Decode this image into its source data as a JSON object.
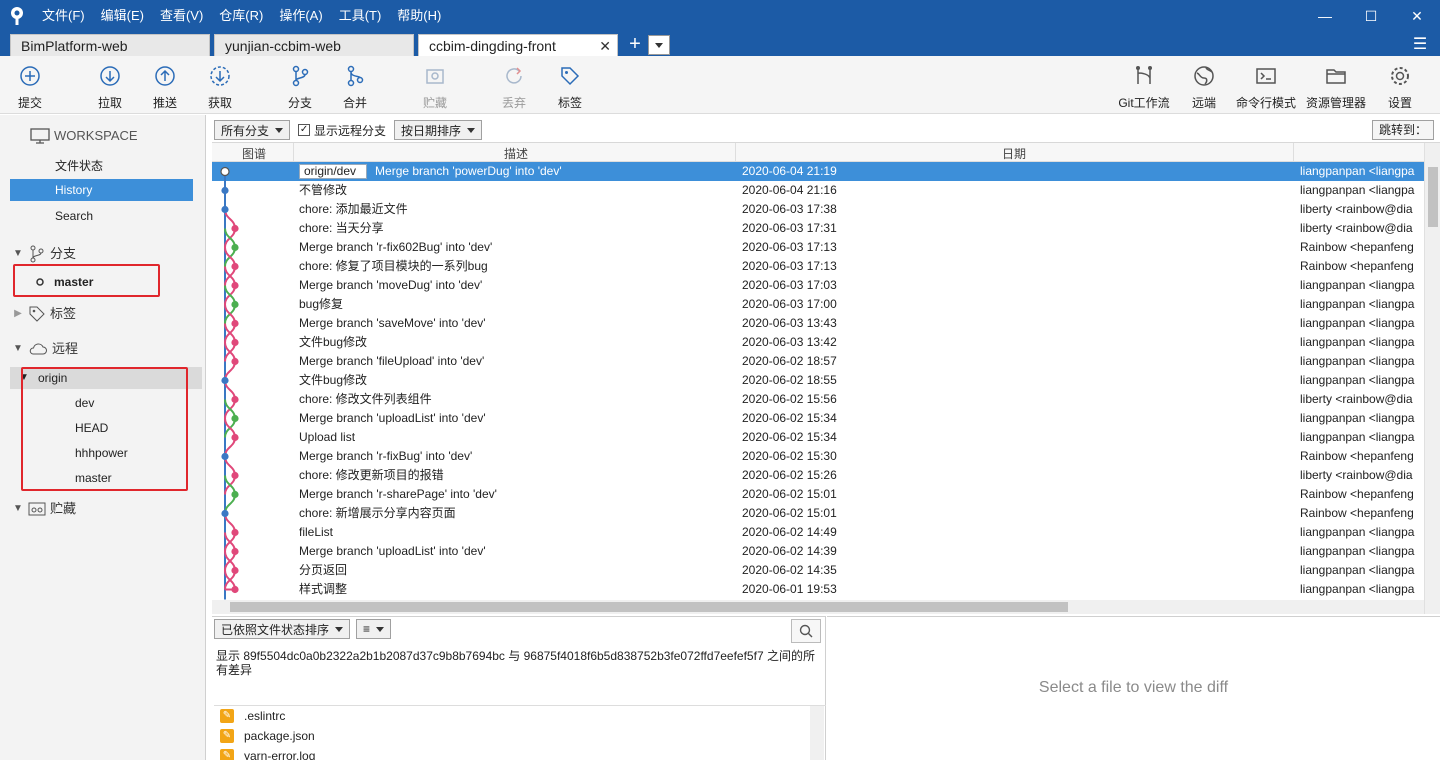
{
  "menu": [
    "文件(F)",
    "编辑(E)",
    "查看(V)",
    "仓库(R)",
    "操作(A)",
    "工具(T)",
    "帮助(H)"
  ],
  "window_controls": {
    "minimize": "—",
    "maximize": "☐",
    "close": "✕"
  },
  "tabs": [
    {
      "label": "BimPlatform-web"
    },
    {
      "label": "yunjian-ccbim-web"
    },
    {
      "label": "ccbim-dingding-front",
      "active": true
    }
  ],
  "tab_close": "✕",
  "tab_add": "+",
  "toolbar": {
    "commit": "提交",
    "pull": "拉取",
    "push": "推送",
    "fetch": "获取",
    "branch": "分支",
    "merge": "合并",
    "stash": "贮藏",
    "discard": "丢弃",
    "tag": "标签",
    "gitflow": "Git工作流",
    "remote": "远端",
    "terminal": "命令行模式",
    "explorer": "资源管理器",
    "settings": "设置"
  },
  "sidebar": {
    "workspace": "WORKSPACE",
    "file_status": "文件状态",
    "history": "History",
    "search": "Search",
    "branches_header": "分支",
    "branch_master": "master",
    "tags_header": "标签",
    "remotes_header": "远程",
    "remote_origin": "origin",
    "remote_branches": [
      "dev",
      "HEAD",
      "hhhpower",
      "master"
    ],
    "stash_header": "贮藏"
  },
  "filter": {
    "branches": "所有分支",
    "show_remote": "显示远程分支",
    "sort": "按日期排序",
    "jump": "跳转到："
  },
  "columns": {
    "graph": "图谱",
    "desc": "描述",
    "date": "日期"
  },
  "commits": [
    {
      "ref": "origin/dev",
      "msg": "Merge branch 'powerDug' into 'dev'",
      "date": "2020-06-04 21:19",
      "author": "liangpanpan <liangpa"
    },
    {
      "msg": "不管修改",
      "date": "2020-06-04 21:16",
      "author": "liangpanpan <liangpa"
    },
    {
      "msg": "chore: 添加最近文件",
      "date": "2020-06-03 17:38",
      "author": "liberty <rainbow@dia"
    },
    {
      "msg": "chore: 当天分享",
      "date": "2020-06-03 17:31",
      "author": "liberty <rainbow@dia"
    },
    {
      "msg": "Merge branch 'r-fix602Bug' into 'dev'",
      "date": "2020-06-03 17:13",
      "author": "Rainbow <hepanfeng"
    },
    {
      "msg": "chore: 修复了项目模块的一系列bug",
      "date": "2020-06-03 17:13",
      "author": "Rainbow <hepanfeng"
    },
    {
      "msg": "Merge branch 'moveDug' into 'dev'",
      "date": "2020-06-03 17:03",
      "author": "liangpanpan <liangpa"
    },
    {
      "msg": "bug修复",
      "date": "2020-06-03 17:00",
      "author": "liangpanpan <liangpa"
    },
    {
      "msg": "Merge branch 'saveMove' into 'dev'",
      "date": "2020-06-03 13:43",
      "author": "liangpanpan <liangpa"
    },
    {
      "msg": "文件bug修改",
      "date": "2020-06-03 13:42",
      "author": "liangpanpan <liangpa"
    },
    {
      "msg": "Merge branch 'fileUpload' into 'dev'",
      "date": "2020-06-02 18:57",
      "author": "liangpanpan <liangpa"
    },
    {
      "msg": "文件bug修改",
      "date": "2020-06-02 18:55",
      "author": "liangpanpan <liangpa"
    },
    {
      "msg": "chore: 修改文件列表组件",
      "date": "2020-06-02 15:56",
      "author": "liberty <rainbow@dia"
    },
    {
      "msg": "Merge branch 'uploadList' into 'dev'",
      "date": "2020-06-02 15:34",
      "author": "liangpanpan <liangpa"
    },
    {
      "msg": "Upload list",
      "date": "2020-06-02 15:34",
      "author": "liangpanpan <liangpa"
    },
    {
      "msg": "Merge branch 'r-fixBug' into 'dev'",
      "date": "2020-06-02 15:30",
      "author": "Rainbow <hepanfeng"
    },
    {
      "msg": "chore: 修改更新项目的报错",
      "date": "2020-06-02 15:26",
      "author": "liberty <rainbow@dia"
    },
    {
      "msg": "Merge branch 'r-sharePage' into 'dev'",
      "date": "2020-06-02 15:01",
      "author": "Rainbow <hepanfeng"
    },
    {
      "msg": "chore: 新增展示分享内容页面",
      "date": "2020-06-02 15:01",
      "author": "Rainbow <hepanfeng"
    },
    {
      "msg": "fileList",
      "date": "2020-06-02 14:49",
      "author": "liangpanpan <liangpa"
    },
    {
      "msg": "Merge branch 'uploadList' into 'dev'",
      "date": "2020-06-02 14:39",
      "author": "liangpanpan <liangpa"
    },
    {
      "msg": "分页返回",
      "date": "2020-06-02 14:35",
      "author": "liangpanpan <liangpa"
    },
    {
      "msg": "样式调整",
      "date": "2020-06-01 19:53",
      "author": "liangpanpan <liangpa"
    }
  ],
  "bottom": {
    "sort_files": "已依照文件状态排序",
    "list_mode": "≡",
    "diff_desc": "显示 89f5504dc0a0b2322a2b1b2087d37c9b8b7694bc 与 96875f4018f6b5d838752b3fe072ffd7eefef5f7 之间的所有差异",
    "files": [
      ".eslintrc",
      "package.json",
      "yarn-error.log"
    ],
    "diff_placeholder": "Select a file to view the diff"
  },
  "colors": {
    "titlebar": "#1c5ba6",
    "selection": "#3d8fd9",
    "annotation": "#e0262c",
    "graph_blue": "#3a78c4",
    "graph_pink": "#e0487a",
    "graph_green": "#4caf50"
  }
}
